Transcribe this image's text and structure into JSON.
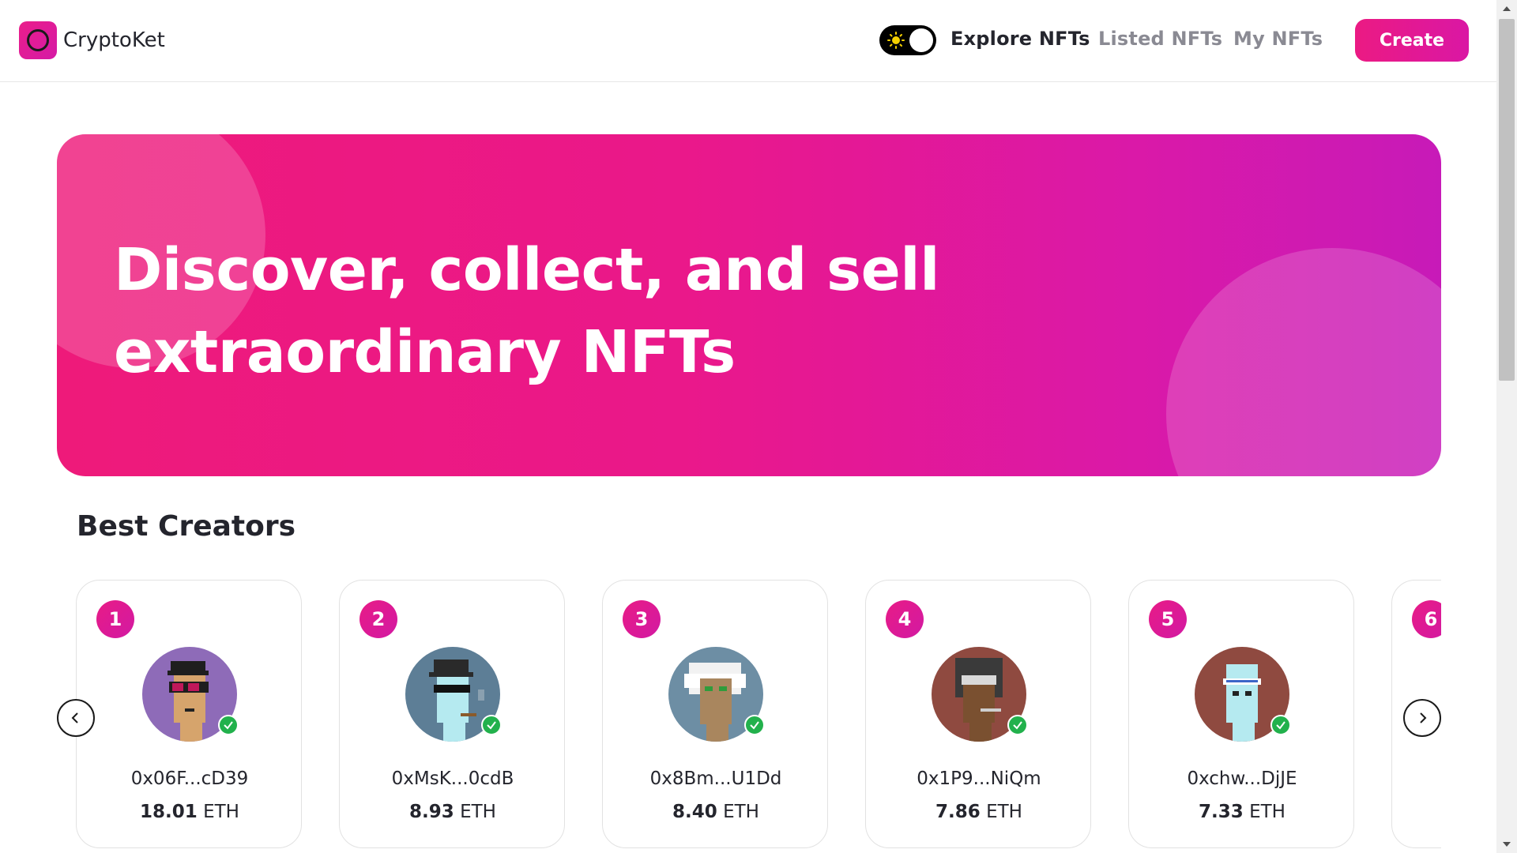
{
  "brand": {
    "name": "CryptoKet"
  },
  "nav": {
    "theme_toggle": {
      "state": "light",
      "icon": "sun-icon"
    },
    "links": [
      {
        "label": "Explore NFTs",
        "active": true
      },
      {
        "label": "Listed NFTs",
        "active": false
      },
      {
        "label": "My NFTs",
        "active": false
      }
    ],
    "create_label": "Create"
  },
  "hero": {
    "title_line1": "Discover, collect, and sell",
    "title_line2": "extraordinary NFTs"
  },
  "best_creators": {
    "title": "Best Creators",
    "creators": [
      {
        "rank": "1",
        "address": "0x06F...cD39",
        "amount": "18.01",
        "unit": "ETH",
        "avatar_bg": "#8e6bb8",
        "verified": true
      },
      {
        "rank": "2",
        "address": "0xMsK...0cdB",
        "amount": "8.93",
        "unit": "ETH",
        "avatar_bg": "#5d7e96",
        "verified": true
      },
      {
        "rank": "3",
        "address": "0x8Bm...U1Dd",
        "amount": "8.40",
        "unit": "ETH",
        "avatar_bg": "#6d8ea4",
        "verified": true
      },
      {
        "rank": "4",
        "address": "0x1P9...NiQm",
        "amount": "7.86",
        "unit": "ETH",
        "avatar_bg": "#8f4a40",
        "verified": true
      },
      {
        "rank": "5",
        "address": "0xchw...DjJE",
        "amount": "7.33",
        "unit": "ETH",
        "avatar_bg": "#8f4a40",
        "verified": true
      },
      {
        "rank": "6"
      }
    ]
  },
  "colors": {
    "accent": "#ea1a8a",
    "accent_end": "#c71ab8",
    "verified": "#22b14c",
    "text": "#24252d",
    "muted": "#8a8a93"
  }
}
